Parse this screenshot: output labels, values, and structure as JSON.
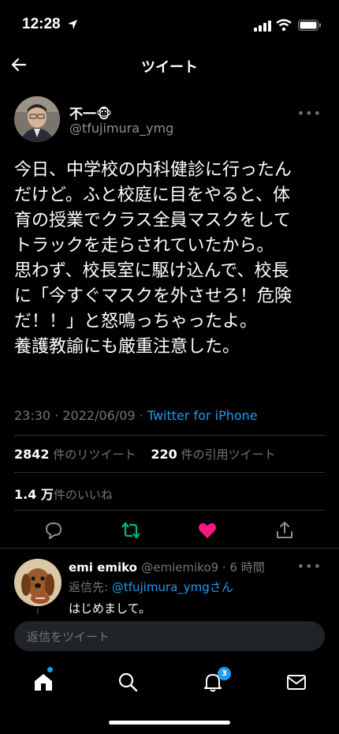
{
  "status_bar": {
    "time": "12:28"
  },
  "header": {
    "title": "ツイート"
  },
  "tweet": {
    "name": "不一🐵",
    "handle": "@tfujimura_ymg",
    "text_lines": [
      "今日、中学校の内科健診に行ったん",
      "だけど。ふと校庭に目をやると、体",
      "育の授業でクラス全員マスクをして",
      "トラックを走らされていたから。",
      "思わず、校長室に駆け込んで、校長",
      "に「今すぐマスクを外させろ！危険",
      "だ！！」と怒鳴っちゃったよ。",
      "養護教諭にも厳重注意した。"
    ],
    "timestamp": "23:30 · 2022/06/09 · ",
    "source": "Twitter for iPhone",
    "retweets": "2842",
    "retweets_label": "件のリツイート",
    "quotes": "220",
    "quotes_label": "件の引用ツイート",
    "likes": "1.4 万",
    "likes_label": "件のいいね"
  },
  "reply": {
    "name": "emi emiko",
    "handle": "@emiemiko9 · 6 時間",
    "to_prefix": "返信先: ",
    "to_user": "@tfujimura_ymg",
    "to_suffix": "さん",
    "text": "はじめまして。"
  },
  "compose": {
    "placeholder": "返信をツイート"
  },
  "tabbar": {
    "notifications_count": "3"
  },
  "colors": {
    "accent": "#1d9bf0",
    "retweet": "#00ba7c",
    "like": "#f91880"
  },
  "icons": [
    "back-arrow-icon",
    "reply-icon",
    "retweet-icon",
    "like-icon",
    "share-icon",
    "home-icon",
    "search-icon",
    "bell-icon",
    "mail-icon"
  ]
}
